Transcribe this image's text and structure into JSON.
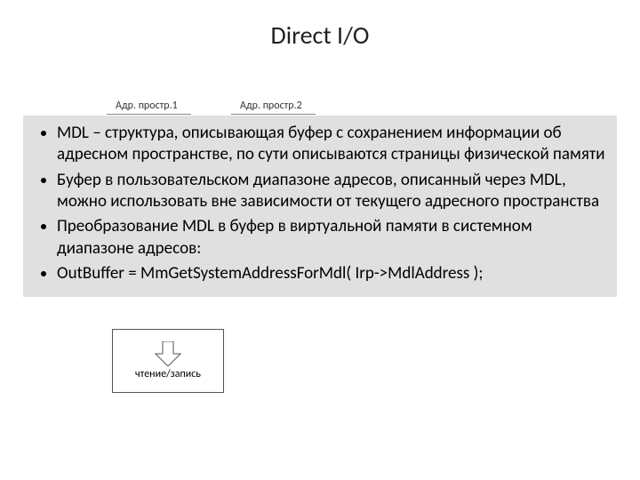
{
  "title": "Direct I/O",
  "labels": {
    "addr1": "Адр. простр.1",
    "addr2": "Адр. простр.2",
    "readwrite": "чтение/запись"
  },
  "bullets": [
    "MDL – структура, описывающая буфер с сохранением информации об адресном пространстве, по сути описываются страницы физической памяти",
    "Буфер в пользовательском диапазоне адресов, описанный через MDL, можно использовать вне зависимости от текущего адресного пространства",
    "Преобразование MDL в буфер в виртуальной памяти в системном диапазоне адресов:",
    "OutBuffer = MmGetSystemAddressForMdl(  Irp->MdlAddress  );"
  ]
}
